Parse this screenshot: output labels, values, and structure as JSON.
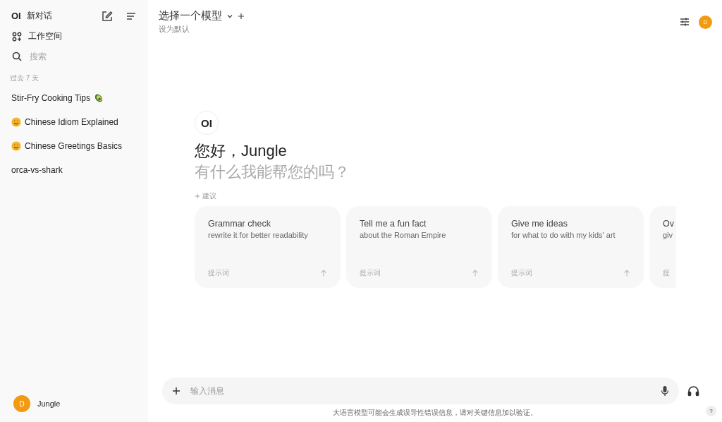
{
  "sidebar": {
    "logo": "OI",
    "new_chat": "新对话",
    "workspace": "工作空间",
    "search": {
      "placeholder": "搜索"
    },
    "section_label": "过去 7 天",
    "chats": [
      {
        "title": "Stir-Fry Cooking Tips",
        "kind": "trailing"
      },
      {
        "title": "Chinese Idiom Explained",
        "kind": "leading"
      },
      {
        "title": "Chinese Greetings Basics",
        "kind": "leading"
      },
      {
        "title": "orca-vs-shark"
      }
    ],
    "user": {
      "initial": "D",
      "name": "Jungle"
    }
  },
  "header": {
    "model_select": "选择一个模型",
    "set_default": "设为默认",
    "avatar": "D"
  },
  "welcome": {
    "logo": "OI",
    "greeting": "您好，Jungle",
    "subtitle": "有什么我能帮您的吗？",
    "suggestions_label": "建议"
  },
  "suggestions": [
    {
      "title": "Grammar check",
      "subtitle": "rewrite it for better readability",
      "tag": "提示词"
    },
    {
      "title": "Tell me a fun fact",
      "subtitle": "about the Roman Empire",
      "tag": "提示词"
    },
    {
      "title": "Give me ideas",
      "subtitle": "for what to do with my kids' art",
      "tag": "提示词"
    },
    {
      "title": "Ov",
      "subtitle": "giv",
      "tag": "提",
      "kind": "clipped"
    }
  ],
  "composer": {
    "placeholder": "输入消息"
  },
  "disclaimer": "大语言模型可能会生成误导性错误信息，请对关键信息加以验证。",
  "help": "?"
}
